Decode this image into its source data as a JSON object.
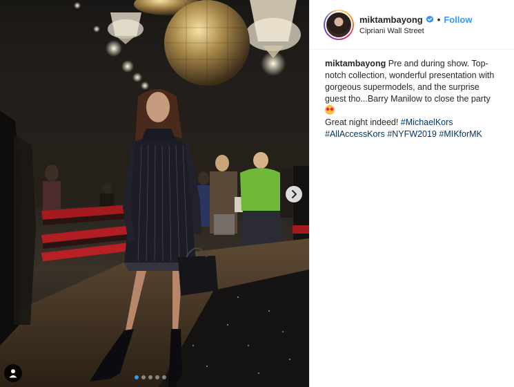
{
  "post": {
    "username": "miktambayong",
    "location": "Cipriani Wall Street",
    "follow_label": "Follow",
    "separator": "•",
    "verified_icon": "verified-badge-icon",
    "caption": {
      "username": "miktambayong",
      "text_line1": " Pre and during show. Top-notch collection, wonderful presentation with gorgeous supermodels, and the surprise guest tho...Barry Manilow to close the party ",
      "emoji": "heart-eyes-emoji",
      "text_line2": "Great night indeed! ",
      "hashtags": [
        "#MichaelKors",
        "#AllAccessKors",
        "#NYFW2019",
        "#MIKforMK"
      ]
    }
  },
  "carousel": {
    "slide_count": 5,
    "active_index": 0,
    "next_icon": "chevron-right-icon",
    "tag_icon": "user-tag-icon"
  },
  "colors": {
    "accent": "#3897f0",
    "hashtag": "#003569",
    "text": "#262626"
  }
}
